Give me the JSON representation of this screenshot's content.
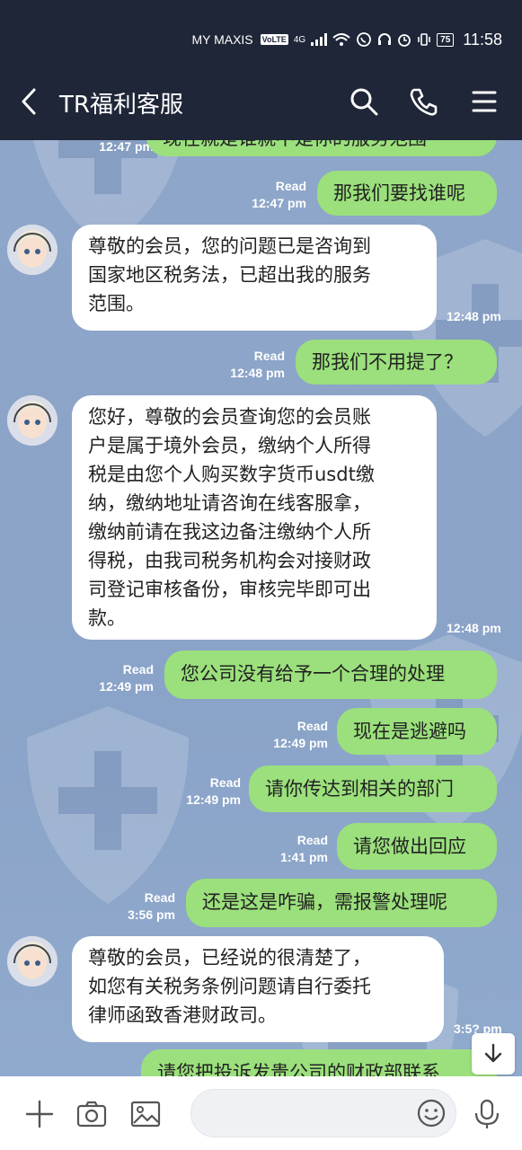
{
  "status_bar": {
    "carrier": "MY MAXIS",
    "volte": "VoLTE",
    "network": "4G",
    "battery": "75",
    "time": "11:58"
  },
  "header": {
    "title": "TR福利客服",
    "icons": [
      "back-arrow-icon",
      "search-icon",
      "phone-icon",
      "menu-icon"
    ]
  },
  "messages": [
    {
      "side": "out",
      "text": "现在就是谁就不是你的服务范围",
      "status": "",
      "time": "12:47 pm"
    },
    {
      "side": "out",
      "text": "那我们要找谁呢",
      "status": "Read",
      "time": "12:47 pm"
    },
    {
      "side": "in",
      "text": "尊敬的会员，您的问题已是咨询到\n国家地区税务法，已超出我的服务\n范围。",
      "time": "12:48 pm"
    },
    {
      "side": "out",
      "text": "那我们不用提了？",
      "status": "Read",
      "time": "12:48 pm"
    },
    {
      "side": "in",
      "text": "您好，尊敬的会员查询您的会员账\n户是属于境外会员，缴纳个人所得\n税是由您个人购买数字货币usdt缴\n纳，缴纳地址请咨询在线客服拿，\n缴纳前请在我这边备注缴纳个人所\n得税，由我司税务机构会对接财政\n司登记审核备份，审核完毕即可出\n款。",
      "time": "12:48 pm"
    },
    {
      "side": "out",
      "text": "您公司没有给予一个合理的处理",
      "status": "Read",
      "time": "12:49 pm"
    },
    {
      "side": "out",
      "text": "现在是逃避吗",
      "status": "Read",
      "time": "12:49 pm"
    },
    {
      "side": "out",
      "text": "请你传达到相关的部门",
      "status": "Read",
      "time": "12:49 pm"
    },
    {
      "side": "out",
      "text": "请您做出回应",
      "status": "Read",
      "time": "1:41 pm"
    },
    {
      "side": "out",
      "text": "还是这是咋骗，需报警处理呢",
      "status": "Read",
      "time": "3:56 pm"
    },
    {
      "side": "in",
      "text": "尊敬的会员，已经说的很清楚了，\n如您有关税务条例问题请自行委托\n律师函致香港财政司。",
      "time": "3:5? pm"
    },
    {
      "side": "out",
      "text": "请您把投诉发贵公司的财政部联系",
      "status": "",
      "time": ""
    }
  ],
  "bottom_bar": {
    "icons": [
      "plus-icon",
      "camera-icon",
      "image-icon",
      "emoji-icon",
      "microphone-icon"
    ],
    "input_placeholder": ""
  },
  "colors": {
    "header_bg": "#1f2638",
    "chat_bg": "#8aa4c8",
    "outgoing_bubble": "#9be07c",
    "incoming_bubble": "#ffffff"
  }
}
